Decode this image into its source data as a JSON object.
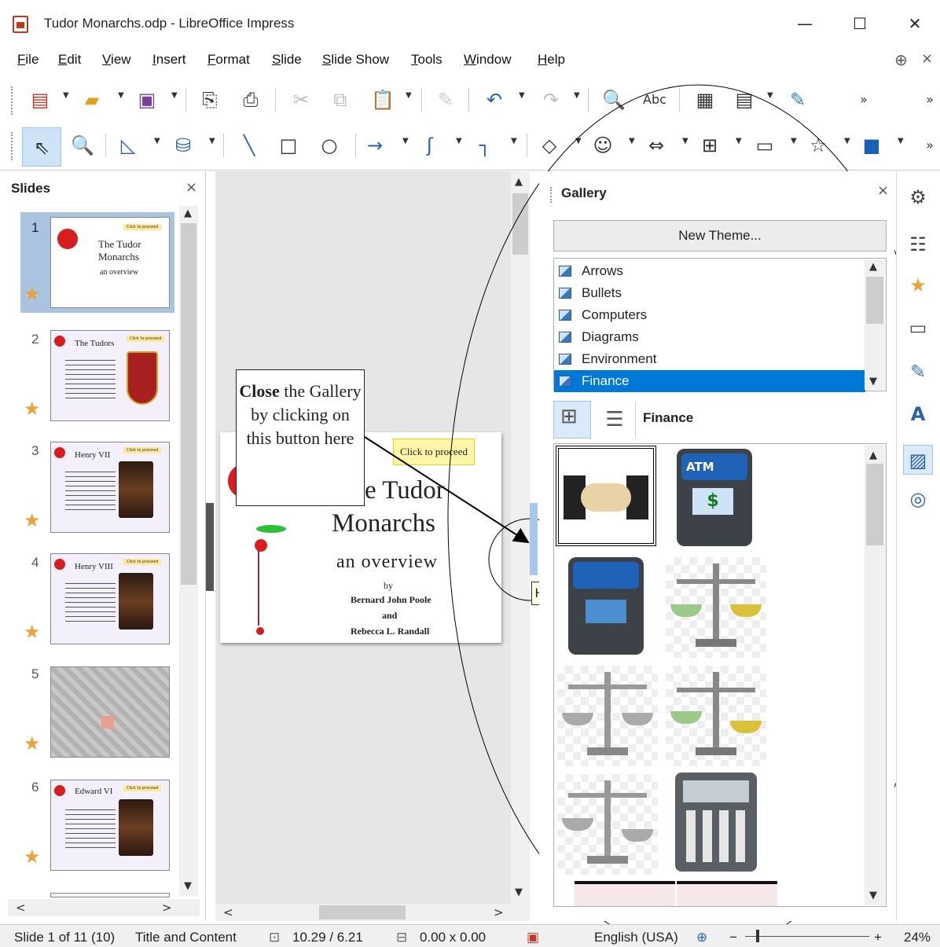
{
  "window": {
    "title": "Tudor Monarchs.odp - LibreOffice Impress",
    "minimize": "—",
    "maximize": "☐",
    "close": "✕"
  },
  "menubar": {
    "items": [
      "File",
      "Edit",
      "View",
      "Insert",
      "Format",
      "Slide",
      "Slide Show",
      "Tools",
      "Window",
      "Help"
    ]
  },
  "slides_panel": {
    "title": "Slides",
    "close": "×",
    "thumbs": [
      {
        "num": "1",
        "title_lines": [
          "The Tudor",
          "Monarchs"
        ],
        "subtitle": "an overview",
        "tag": "Click to proceed"
      },
      {
        "num": "2",
        "title_lines": [
          "The Tudors"
        ],
        "tag": "Click to proceed"
      },
      {
        "num": "3",
        "title_lines": [
          "Henry VII"
        ],
        "tag": "Click to proceed"
      },
      {
        "num": "4",
        "title_lines": [
          "Henry VIII"
        ],
        "tag": "Click to proceed"
      },
      {
        "num": "5",
        "title_lines": [
          ""
        ],
        "tag": ""
      },
      {
        "num": "6",
        "title_lines": [
          "Edward VI"
        ],
        "tag": "Click to proceed"
      }
    ]
  },
  "slide": {
    "tag": "Click to proceed",
    "title_line1": "e Tudor",
    "title_line2": "Monarchs",
    "subtitle": "an overview",
    "by": "by",
    "author1": "Bernard John Poole",
    "and": "and",
    "author2": "Rebecca L. Randall"
  },
  "callout": {
    "bold": "Close",
    "rest": " the Gallery by clicking on this button here"
  },
  "tooltip": "Hide",
  "gallery": {
    "title": "Gallery",
    "close": "×",
    "new_theme": "New Theme...",
    "themes": [
      "Arrows",
      "Bullets",
      "Computers",
      "Diagrams",
      "Environment",
      "Finance"
    ],
    "selected_theme": "Finance",
    "items": [
      "handshake",
      "atm",
      "atm-globe",
      "scale-coins",
      "scale",
      "scale-coins",
      "scale",
      "calculator"
    ]
  },
  "status": {
    "slide": "Slide 1 of 11 (10)",
    "layout": "Title and Content",
    "position": "10.29 / 6.21",
    "size": "0.00 x 0.00",
    "language": "English (USA)",
    "zoom": "24%"
  },
  "colors": {
    "accent": "#0078d7",
    "star": "#e9a33a",
    "rose": "#d71d1d"
  }
}
